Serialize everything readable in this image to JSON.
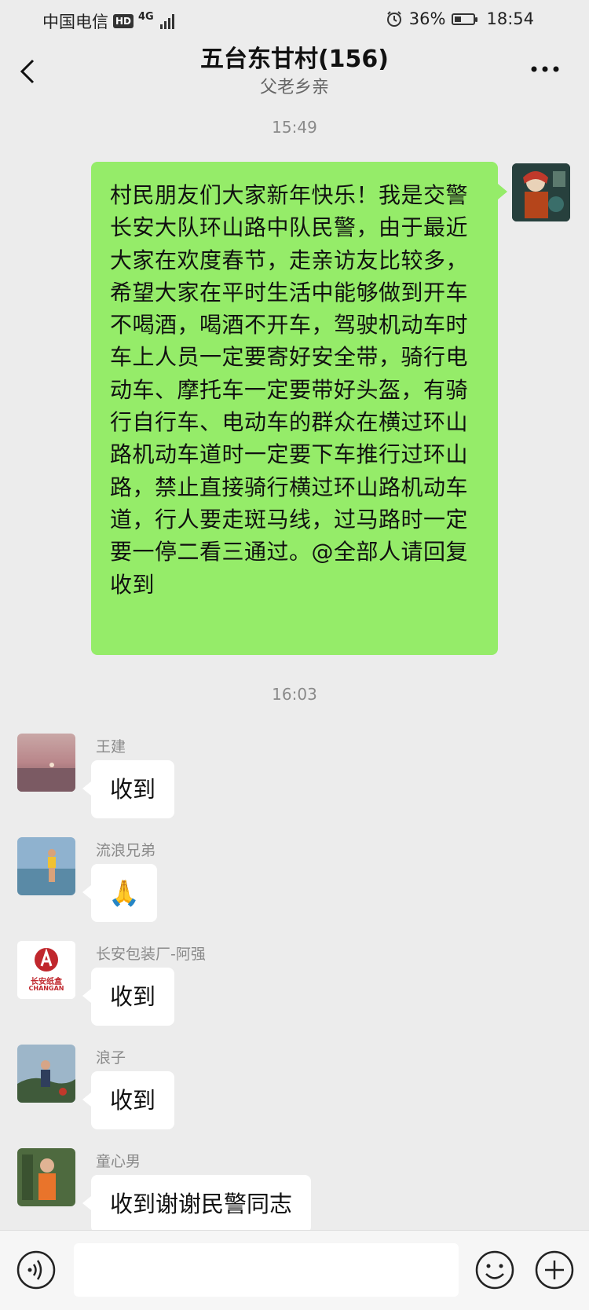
{
  "status_bar": {
    "carrier": "中国电信",
    "hd": "HD",
    "network": "4G",
    "battery_percent_text": "36%",
    "battery_level": 0.36,
    "time": "18:54"
  },
  "header": {
    "title": "五台东甘村(156)",
    "subtitle": "父老乡亲",
    "back_icon": "chevron-left-icon",
    "more_icon": "more-dots-icon"
  },
  "messages": {
    "time_1": "15:49",
    "outgoing_text": "村民朋友们大家新年快乐！我是交警长安大队环山路中队民警，由于最近大家在欢度春节，走亲访友比较多，希望大家在平时生活中能够做到开车不喝酒，喝酒不开车，驾驶机动车时车上人员一定要寄好安全带，骑行电动车、摩托车一定要带好头盔，有骑行自行车、电动车的群众在横过环山路机动车道时一定要下车推行过环山路，禁止直接骑行横过环山路机动车道，行人要走斑马线，过马路时一定要一停二看三通过。@全部人请回复收到",
    "time_2": "16:03",
    "replies": [
      {
        "sender": "王建",
        "text": "收到"
      },
      {
        "sender": "流浪兄弟",
        "emoji": "🙏"
      },
      {
        "sender": "长安包装厂-阿强",
        "text": "收到"
      },
      {
        "sender": "浪子",
        "text": "收到"
      },
      {
        "sender": "童心男",
        "text": "收到谢谢民警同志"
      }
    ],
    "logo_text": "长安纸盒",
    "logo_subtext": "CHANGAN"
  },
  "input_bar": {
    "voice_icon": "voice-icon",
    "emoji_icon": "emoji-icon",
    "plus_icon": "plus-icon",
    "input_value": ""
  },
  "colors": {
    "background": "#ececec",
    "outgoing_bubble": "#95ec69",
    "incoming_bubble": "#ffffff",
    "meta_text": "#8a8a8a"
  }
}
